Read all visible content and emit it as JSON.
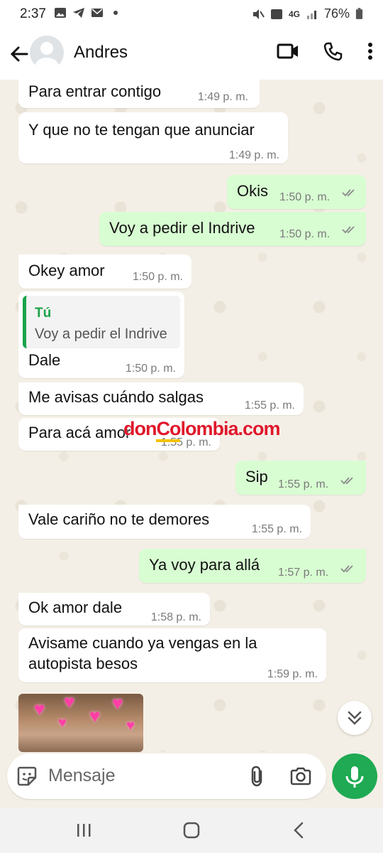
{
  "status_bar": {
    "time": "2:37",
    "battery": "76%",
    "network": "4G"
  },
  "header": {
    "contact_name": "Andres"
  },
  "messages": [
    {
      "direction": "in",
      "text": "Para entrar contigo",
      "time": "1:49 p. m."
    },
    {
      "direction": "in",
      "text": "Y que no te tengan que anunciar",
      "time": "1:49 p. m."
    },
    {
      "direction": "out",
      "text": "Okis",
      "time": "1:50 p. m."
    },
    {
      "direction": "out",
      "text": "Voy a pedir el Indrive",
      "time": "1:50 p. m."
    },
    {
      "direction": "in",
      "text": "Okey amor",
      "time": "1:50 p. m."
    },
    {
      "direction": "in",
      "quote_author": "Tú",
      "quote_text": "Voy a pedir el Indrive",
      "text": "Dale",
      "time": "1:50 p. m."
    },
    {
      "direction": "in",
      "text": "Me avisas cuándo salgas",
      "time": "1:55 p. m."
    },
    {
      "direction": "in",
      "text": "Para acá amor",
      "time": "1:55 p. m."
    },
    {
      "direction": "out",
      "text": "Sip",
      "time": "1:55 p. m."
    },
    {
      "direction": "in",
      "text": "Vale cariño no te demores",
      "time": "1:55 p. m."
    },
    {
      "direction": "out",
      "text": "Ya voy para allá",
      "time": "1:57 p. m."
    },
    {
      "direction": "in",
      "text": "Ok amor dale",
      "time": "1:58 p. m."
    },
    {
      "direction": "in",
      "text": "Avisame cuando ya vengas en la\nautopista besos",
      "time": "1:59 p. m."
    }
  ],
  "watermark": {
    "part1": "don",
    "part2": "Co",
    "part3": "lombia.com"
  },
  "composer": {
    "placeholder": "Mensaje"
  },
  "colors": {
    "outgoing_bubble": "#d8fdd2",
    "incoming_bubble": "#ffffff",
    "accent_green": "#1faa53",
    "chat_background": "#f4efe6"
  }
}
